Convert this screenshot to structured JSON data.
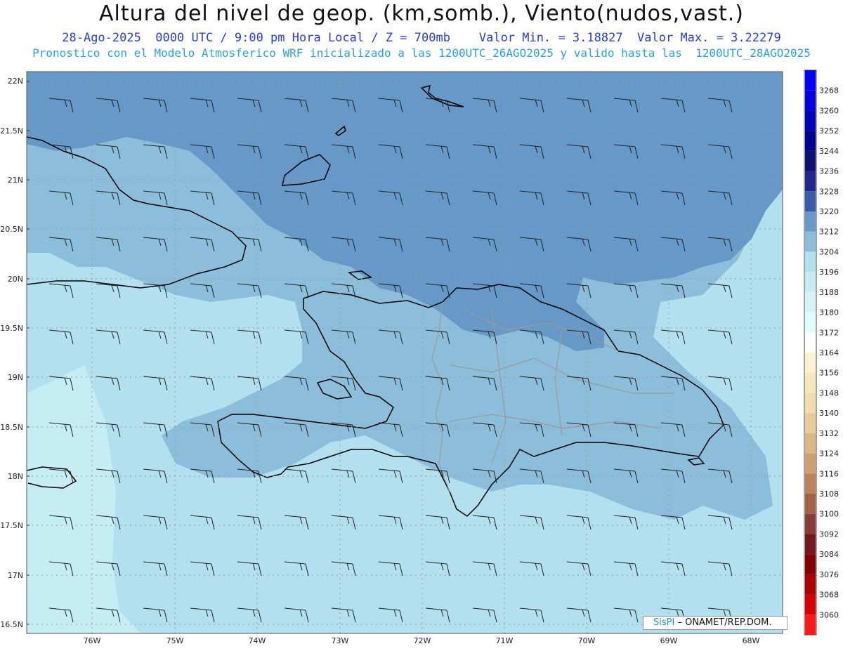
{
  "header": {
    "title": "Altura del nivel de geop. (km,somb.), Viento(nudos,vast.)",
    "subtitle": "28-Ago-2025  0000 UTC / 9:00 pm Hora Local / Z = 700mb    Valor Min. = 3.18827  Valor Max. = 3.22279",
    "subtitle2": "Pronostico con el Modelo Atmosferico WRF inicializado a las 1200UTC_26AGO2025 y valido hasta las  1200UTC_28AGO2025"
  },
  "map": {
    "lat_labels": [
      "22N",
      "21.5N",
      "21N",
      "20.5N",
      "20N",
      "19.5N",
      "19N",
      "18.5N",
      "18N",
      "17.5N",
      "17N",
      "16.5N"
    ],
    "lon_labels": [
      "76W",
      "75W",
      "74W",
      "73W",
      "72W",
      "71W",
      "70W",
      "69W",
      "68W"
    ],
    "colors": {
      "shade_low": "#c6ecf4",
      "shade_mid": "#b3e0ee",
      "shade_high": "#8cbddb",
      "shade_top": "#6698c8",
      "coastline": "#000000",
      "boundaries": "#9a9a9a",
      "grid": "#9a9a9a"
    }
  },
  "colorbar": {
    "labels": [
      "3268",
      "3260",
      "3252",
      "3244",
      "3236",
      "3228",
      "3220",
      "3212",
      "3204",
      "3196",
      "3188",
      "3180",
      "3172",
      "3164",
      "3156",
      "3148",
      "3140",
      "3132",
      "3124",
      "3116",
      "3108",
      "3100",
      "3092",
      "3084",
      "3076",
      "3068",
      "3060"
    ],
    "colors": [
      "#0000ff",
      "#0000e0",
      "#0000b8",
      "#000090",
      "#101070",
      "#202890",
      "#3a5aa8",
      "#6698c8",
      "#8cbddb",
      "#b3e0ee",
      "#c6ecf4",
      "#d4f4f8",
      "#e2fbfc",
      "#ffffff",
      "#fbf2cf",
      "#f6e7c0",
      "#f0dcae",
      "#e8cc98",
      "#dbb784",
      "#cfa070",
      "#bb835c",
      "#a5604a",
      "#8c3c38",
      "#74181f",
      "#820000",
      "#aa0000",
      "#d60000",
      "#ff1a1a"
    ]
  },
  "credit": {
    "brand": "SisPI",
    "text": "– ONAMET/REP.DOM."
  }
}
